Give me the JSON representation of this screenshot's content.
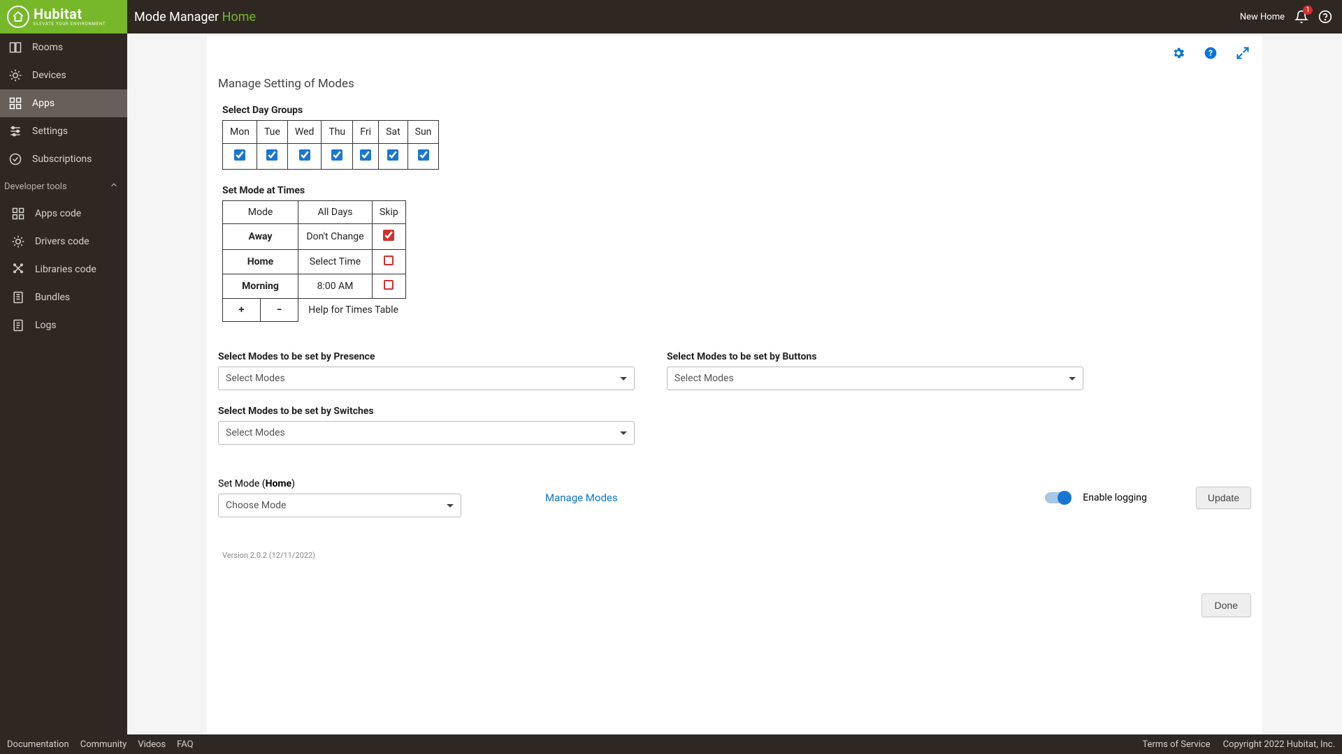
{
  "brand": {
    "name": "Hubitat",
    "tagline": "ELEVATE YOUR ENVIRONMENT"
  },
  "breadcrumb": {
    "app": "Mode Manager",
    "mode": "Home"
  },
  "topbar": {
    "location": "New Home",
    "notif_count": "1"
  },
  "sidebar": {
    "items": [
      {
        "label": "Rooms"
      },
      {
        "label": "Devices"
      },
      {
        "label": "Apps"
      },
      {
        "label": "Settings"
      },
      {
        "label": "Subscriptions"
      }
    ],
    "dev_section": "Developer tools",
    "dev_items": [
      {
        "label": "Apps code"
      },
      {
        "label": "Drivers code"
      },
      {
        "label": "Libraries code"
      },
      {
        "label": "Bundles"
      },
      {
        "label": "Logs"
      }
    ]
  },
  "footer": {
    "left": [
      "Documentation",
      "Community",
      "Videos",
      "FAQ"
    ],
    "right": [
      "Terms of Service",
      "Copyright 2022 Hubitat, Inc."
    ]
  },
  "page": {
    "title": "Manage Setting of Modes",
    "day_groups_label": "Select Day Groups",
    "days": [
      "Mon",
      "Tue",
      "Wed",
      "Thu",
      "Fri",
      "Sat",
      "Sun"
    ],
    "set_times_label": "Set Mode at Times",
    "times_headers": [
      "Mode",
      "All Days",
      "Skip"
    ],
    "times_rows": [
      {
        "mode": "Away",
        "style": "away",
        "time": "Don't Change",
        "skip": true
      },
      {
        "mode": "Home",
        "style": "home",
        "time": "Select Time",
        "time_style": "green",
        "skip": false
      },
      {
        "mode": "Morning",
        "style": "morning",
        "time": "8:00 AM",
        "time_style": "blue",
        "skip": false
      }
    ],
    "help_times": "Help for Times Table",
    "presence_label": "Select Modes to be set by Presence",
    "buttons_label": "Select Modes to be set by Buttons",
    "switches_label": "Select Modes to be set by Switches",
    "select_placeholder": "Select Modes",
    "set_mode_prefix": "Set Mode (",
    "set_mode_value": "Home",
    "set_mode_suffix": ")",
    "choose_mode": "Choose Mode",
    "manage_modes": "Manage Modes",
    "enable_logging": "Enable logging",
    "update": "Update",
    "version": "Version 2.0.2 (12/11/2022)",
    "done": "Done"
  }
}
